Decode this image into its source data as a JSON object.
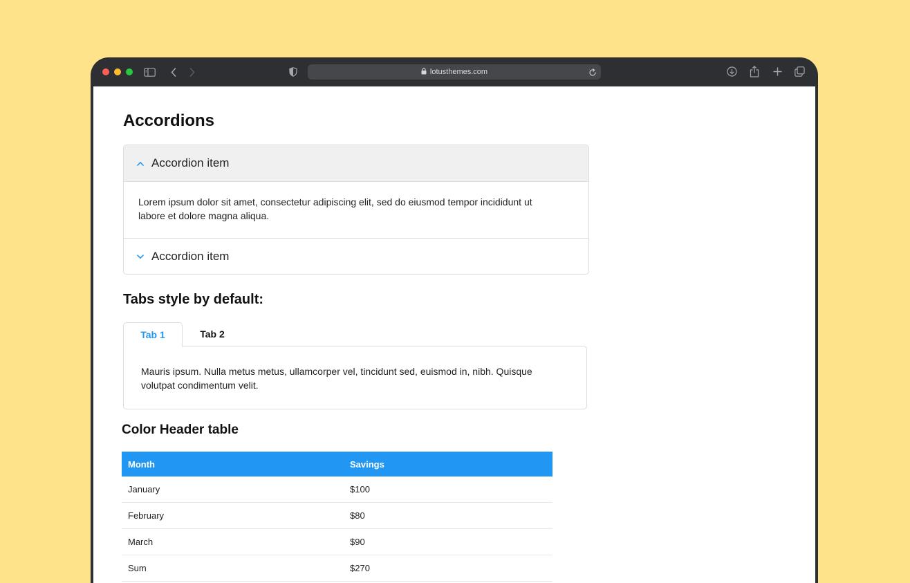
{
  "browser": {
    "url": "lotusthemes.com",
    "colors": {
      "frame": "#2E2F33",
      "url_bar": "#46474B",
      "background": "#FFE38A"
    },
    "icons": [
      "sidebar-icon",
      "back-icon",
      "forward-icon",
      "shield-icon",
      "lock-icon",
      "reload-icon",
      "download-icon",
      "share-icon",
      "new-tab-icon",
      "tabs-overview-icon"
    ]
  },
  "page": {
    "title": "Accordions",
    "accordion": {
      "items": [
        {
          "label": "Accordion item",
          "expanded": true,
          "body": "Lorem ipsum dolor sit amet, consectetur adipiscing elit, sed do eiusmod tempor incididunt ut labore et dolore magna aliqua."
        },
        {
          "label": "Accordion item",
          "expanded": false
        }
      ]
    },
    "tabs_section": {
      "title": "Tabs style by default:",
      "tabs": [
        {
          "label": "Tab 1",
          "active": true
        },
        {
          "label": "Tab 2",
          "active": false
        }
      ],
      "content": "Mauris ipsum. Nulla metus metus, ullamcorper vel, tincidunt sed, euismod in, nibh. Quisque volutpat condimentum velit."
    },
    "table_section": {
      "title": "Color Header table",
      "header_color": "#2196F3",
      "columns": [
        "Month",
        "Savings"
      ],
      "rows": [
        [
          "January",
          "$100"
        ],
        [
          "February",
          "$80"
        ],
        [
          "March",
          "$90"
        ],
        [
          "Sum",
          "$270"
        ]
      ]
    }
  }
}
